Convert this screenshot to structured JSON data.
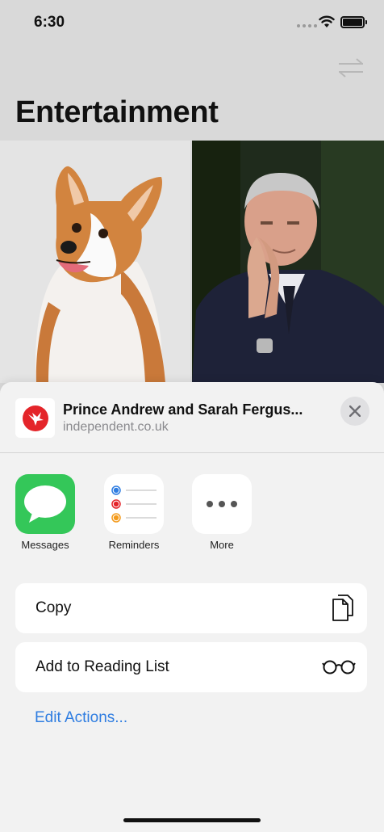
{
  "status_bar": {
    "time": "6:30"
  },
  "page": {
    "title": "Entertainment"
  },
  "share_sheet": {
    "article_title": "Prince Andrew and Sarah Fergus...",
    "article_domain": "independent.co.uk",
    "apps": [
      {
        "label": "Messages",
        "icon": "messages-icon",
        "color": "#34c759"
      },
      {
        "label": "Reminders",
        "icon": "reminders-icon",
        "color": "#ffffff"
      },
      {
        "label": "More",
        "icon": "more-icon",
        "color": "#ffffff"
      }
    ],
    "actions": [
      {
        "label": "Copy",
        "icon": "copy-icon"
      },
      {
        "label": "Add to Reading List",
        "icon": "glasses-icon"
      }
    ],
    "edit_actions": "Edit Actions..."
  },
  "colors": {
    "accent": "#2f7de1",
    "logo_red": "#e4252a"
  }
}
